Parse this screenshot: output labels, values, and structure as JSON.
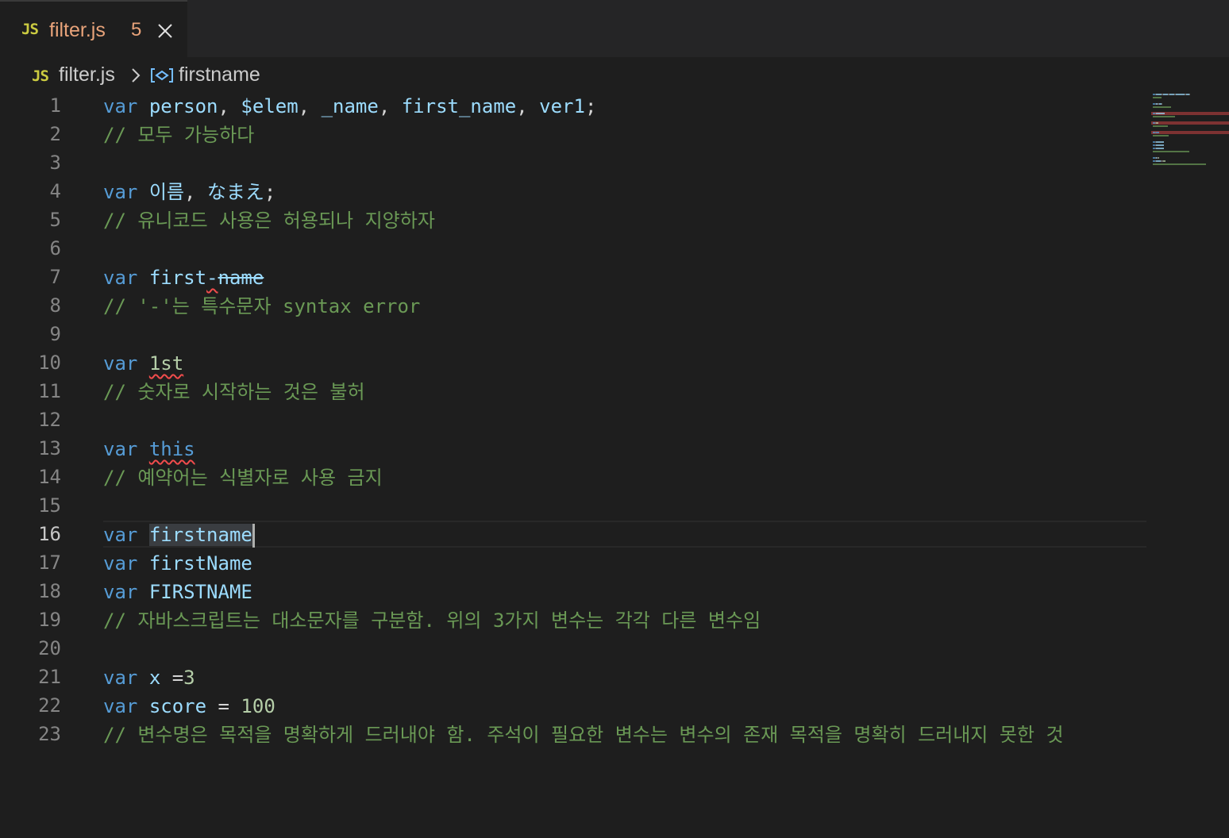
{
  "tab": {
    "icon_text": "JS",
    "filename": "filter.js",
    "problem_count": "5",
    "icon": "close-icon"
  },
  "breadcrumb": {
    "icon_text": "JS",
    "file": "filter.js",
    "chevron_icon": "chevron-right-icon",
    "symbol_icon": "variable-icon",
    "symbol": "firstname"
  },
  "editor": {
    "active_line": 16,
    "lines": [
      {
        "n": "1",
        "segs": [
          [
            "kw",
            "var"
          ],
          [
            "pl",
            " "
          ],
          [
            "id",
            "person"
          ],
          [
            "pl",
            ", "
          ],
          [
            "id",
            "$elem"
          ],
          [
            "pl",
            ", "
          ],
          [
            "id",
            "_name"
          ],
          [
            "pl",
            ", "
          ],
          [
            "id",
            "first_name"
          ],
          [
            "pl",
            ", "
          ],
          [
            "id",
            "ver1"
          ],
          [
            "pl",
            ";"
          ]
        ]
      },
      {
        "n": "2",
        "segs": [
          [
            "cm",
            "// 모두 가능하다"
          ]
        ]
      },
      {
        "n": "3",
        "segs": []
      },
      {
        "n": "4",
        "segs": [
          [
            "kw",
            "var"
          ],
          [
            "pl",
            " "
          ],
          [
            "id",
            "이름"
          ],
          [
            "pl",
            ", "
          ],
          [
            "id",
            "なまえ"
          ],
          [
            "pl",
            ";"
          ]
        ]
      },
      {
        "n": "5",
        "segs": [
          [
            "cm",
            "// 유니코드 사용은 허용되나 지양하자"
          ]
        ]
      },
      {
        "n": "6",
        "segs": []
      },
      {
        "n": "7",
        "segs": [
          [
            "kw",
            "var"
          ],
          [
            "pl",
            " "
          ],
          [
            "id",
            "first"
          ],
          [
            "idsq",
            "-"
          ],
          [
            "idst",
            "name"
          ]
        ]
      },
      {
        "n": "8",
        "segs": [
          [
            "cm",
            "// '-'는 특수문자 syntax error"
          ]
        ]
      },
      {
        "n": "9",
        "segs": []
      },
      {
        "n": "10",
        "segs": [
          [
            "kw",
            "var"
          ],
          [
            "pl",
            " "
          ],
          [
            "numsq",
            "1st"
          ]
        ]
      },
      {
        "n": "11",
        "segs": [
          [
            "cm",
            "// 숫자로 시작하는 것은 불허"
          ]
        ]
      },
      {
        "n": "12",
        "segs": []
      },
      {
        "n": "13",
        "segs": [
          [
            "kw",
            "var"
          ],
          [
            "pl",
            " "
          ],
          [
            "kwsq",
            "this"
          ]
        ]
      },
      {
        "n": "14",
        "segs": [
          [
            "cm",
            "// 예약어는 식별자로 사용 금지"
          ]
        ]
      },
      {
        "n": "15",
        "segs": []
      },
      {
        "n": "16",
        "segs": [
          [
            "kw",
            "var"
          ],
          [
            "pl",
            " "
          ],
          [
            "idsel",
            "firstname"
          ],
          [
            "cursor",
            ""
          ]
        ]
      },
      {
        "n": "17",
        "segs": [
          [
            "kw",
            "var"
          ],
          [
            "pl",
            " "
          ],
          [
            "id",
            "firstName"
          ]
        ]
      },
      {
        "n": "18",
        "segs": [
          [
            "kw",
            "var"
          ],
          [
            "pl",
            " "
          ],
          [
            "id",
            "FIRSTNAME"
          ]
        ]
      },
      {
        "n": "19",
        "segs": [
          [
            "cm",
            "// 자바스크립트는 대소문자를 구분함. 위의 3가지 변수는 각각 다른 변수임"
          ]
        ]
      },
      {
        "n": "20",
        "segs": []
      },
      {
        "n": "21",
        "segs": [
          [
            "kw",
            "var"
          ],
          [
            "pl",
            " "
          ],
          [
            "id",
            "x"
          ],
          [
            "pl",
            " ="
          ],
          [
            "num",
            "3"
          ]
        ]
      },
      {
        "n": "22",
        "segs": [
          [
            "kw",
            "var"
          ],
          [
            "pl",
            " "
          ],
          [
            "id",
            "score"
          ],
          [
            "pl",
            " = "
          ],
          [
            "num",
            "100"
          ]
        ]
      },
      {
        "n": "23",
        "segs": [
          [
            "cm",
            "// 변수명은 목적을 명확하게 드러내야 함. 주석이 필요한 변수는 변수의 존재 목적을 명확히 드러내지 못한 것"
          ]
        ]
      }
    ]
  },
  "colors": {
    "background": "#1e1e1e",
    "tabbar": "#252526",
    "keyword": "#569cd6",
    "identifier": "#9cdcfe",
    "number": "#b5cea8",
    "comment": "#6a9955",
    "error": "#f14c4c",
    "tab_modified": "#e8a37a",
    "js_icon": "#cbcb41"
  }
}
